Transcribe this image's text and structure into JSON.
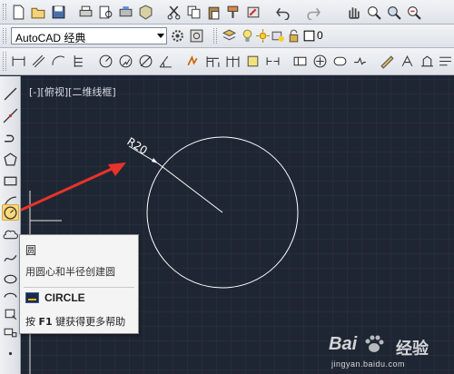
{
  "workspace": {
    "value": "AutoCAD 经典"
  },
  "layer": {
    "current": "0"
  },
  "viewport": {
    "label": "[-][俯视][二维线框]"
  },
  "drawing": {
    "dimension_text": "R20"
  },
  "tooltip": {
    "title": "圆",
    "description": "用圆心和半径创建圆",
    "command": "CIRCLE",
    "help_prefix": "按 ",
    "help_key": "F1",
    "help_suffix": " 键获得更多帮助"
  },
  "watermark": {
    "brand": "Bai",
    "brand2": "经验",
    "url": "jingyan.baidu.com"
  },
  "colors": {
    "canvas": "#1f2633",
    "circle": "#ffffff",
    "arrow": "#e8332a",
    "highlight": "#fcd97a"
  },
  "icons": {
    "standard_toolbar": [
      "new-icon",
      "open-icon",
      "save-icon",
      "print-icon",
      "print-preview-icon",
      "publish-icon",
      "3d-dwf-icon",
      "cut-icon",
      "copy-icon",
      "paste-icon",
      "match-properties-icon",
      "block-editor-icon",
      "undo-icon",
      "redo-icon",
      "pan-icon",
      "zoom-realtime-icon",
      "zoom-window-icon",
      "zoom-previous-icon"
    ],
    "draw_toolbar": [
      "line-icon",
      "construction-line-icon",
      "polyline-icon",
      "polygon-icon",
      "rectangle-icon",
      "arc-icon",
      "circle-icon",
      "revision-cloud-icon",
      "spline-icon",
      "ellipse-icon",
      "ellipse-arc-icon",
      "insert-block-icon",
      "make-block-icon",
      "point-icon"
    ]
  }
}
